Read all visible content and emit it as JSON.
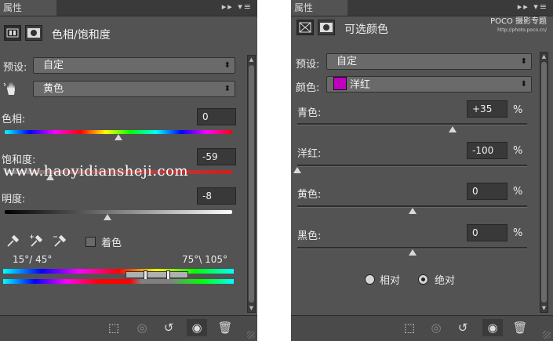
{
  "left_panel": {
    "tab_label": "属性",
    "tab_menu_icons": "▸▸ ▾≡",
    "title": "色相/饱和度",
    "preset_label": "预设:",
    "preset_value": "自定",
    "channel_value": "黄色",
    "hue_label": "色相:",
    "hue_value": "0",
    "hue_level": 0.5,
    "saturation_label": "饱和度:",
    "saturation_value": "-59",
    "saturation_level": 0.2,
    "lightness_label": "明度:",
    "lightness_value": "-8",
    "lightness_level": 0.45,
    "colorize_label": "着色",
    "range_left": "15°/ 45°",
    "range_right": "75°\\ 105°",
    "watermark": "www.haoyidiansheji.com"
  },
  "right_panel": {
    "tab_label": "属性",
    "tab_menu_icons": "▸▸ ▾≡",
    "title": "可选颜色",
    "logo_text": "POCO 摄影专题",
    "logo_url_text": "http://photo.poco.cn/",
    "preset_label": "预设:",
    "preset_value": "自定",
    "color_label": "颜色:",
    "color_value": "洋红",
    "color_swatch": "#c000c0",
    "pct": "%",
    "sliders": [
      {
        "label": "青色:",
        "value": "+35",
        "level": 0.675
      },
      {
        "label": "洋红:",
        "value": "-100",
        "level": 0.0
      },
      {
        "label": "黄色:",
        "value": "0",
        "level": 0.5
      },
      {
        "label": "黑色:",
        "value": "0",
        "level": 0.5
      }
    ],
    "relative_label": "相对",
    "absolute_label": "绝对"
  },
  "footer_icons": [
    "clip-to-layer-icon",
    "eye-preview-icon",
    "reset-icon",
    "visibility-icon",
    "trash-icon"
  ]
}
